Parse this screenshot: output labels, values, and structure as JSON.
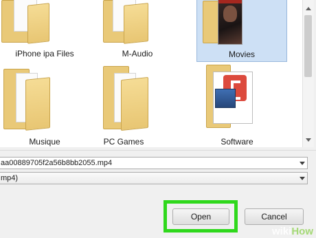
{
  "folders": [
    {
      "name": "iPhone ipa Files",
      "selected": false
    },
    {
      "name": "M-Audio",
      "selected": false
    },
    {
      "name": "Movies",
      "selected": true
    },
    {
      "name": "Musique",
      "selected": false
    },
    {
      "name": "PC Games",
      "selected": false
    },
    {
      "name": "Software",
      "selected": false
    }
  ],
  "file_name_field": {
    "value": "aa00889705f2a56b8bb2055.mp4"
  },
  "file_type_select": {
    "value": "mp4)"
  },
  "buttons": {
    "open_label": "Open",
    "cancel_label": "Cancel"
  },
  "watermark": {
    "wiki": "wiki",
    "how": "How"
  },
  "colors": {
    "selection": "#cde0f5",
    "highlight_outline": "#2fd81c",
    "folder": "#e9c978"
  }
}
